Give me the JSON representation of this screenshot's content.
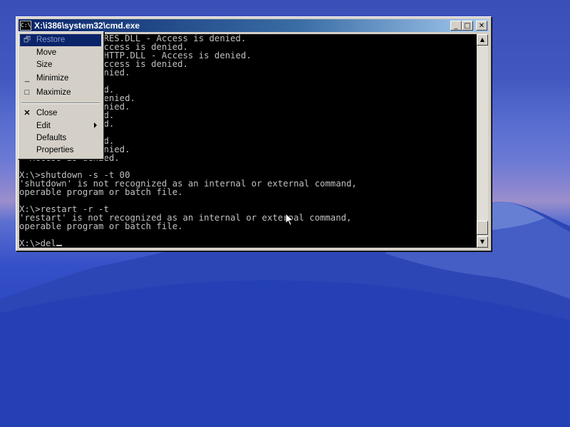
{
  "window": {
    "title": "X:\\i386\\system32\\cmd.exe",
    "icon_label": "C:\\"
  },
  "titlebar_buttons": {
    "minimize": "_",
    "maximize": "□",
    "close": "✕"
  },
  "console": {
    "lines": [
      "386_M~26.18~\\RTCRES.DLL - Access is denied.",
      "386_M~26.18~ - Access is denied.",
      "386_M~29.18~\\WINHTTP.DLL - Access is denied.",
      "386_M~29.18~ - Access is denied.",
      "  - Access is denied.",
      "   is denied.",
      "  ccess is denied.",
      "   - Access is denied.",
      "  - Access is denied.",
      " Access is denied.",
      "  ccess is denied.",
      "  ss is denied.",
      "  ccess is denied.",
      "  - Access is denied.",
      "  Access is denied.",
      "",
      "X:\\>shutdown -s -t 00",
      "'shutdown' is not recognized as an internal or external command,",
      "operable program or batch file.",
      "",
      "X:\\>restart -r -t",
      "'restart' is not recognized as an internal or external command,",
      "operable program or batch file.",
      "",
      "X:\\>del"
    ]
  },
  "system_menu": {
    "items": [
      {
        "label": "Restore",
        "icon": "restore-icon",
        "glyph": "🗗",
        "state": "disabled-highlighted"
      },
      {
        "label": "Move",
        "icon": "",
        "glyph": ""
      },
      {
        "label": "Size",
        "icon": "",
        "glyph": ""
      },
      {
        "label": "Minimize",
        "icon": "minimize-icon",
        "glyph": "_"
      },
      {
        "label": "Maximize",
        "icon": "maximize-icon",
        "glyph": "□"
      },
      {
        "label": "Close",
        "icon": "close-icon",
        "glyph": "✕"
      },
      {
        "label": "Edit",
        "icon": "",
        "glyph": "",
        "submenu": true
      },
      {
        "label": "Defaults",
        "icon": "",
        "glyph": ""
      },
      {
        "label": "Properties",
        "icon": "",
        "glyph": ""
      }
    ]
  },
  "scrollbar": {
    "up_arrow": "▲",
    "down_arrow": "▼"
  },
  "colors": {
    "console_bg": "#000000",
    "console_fg": "#c0c0c0",
    "titlebar_start": "#0a246a",
    "titlebar_end": "#a6caf0",
    "menu_highlight": "#0a246a"
  }
}
